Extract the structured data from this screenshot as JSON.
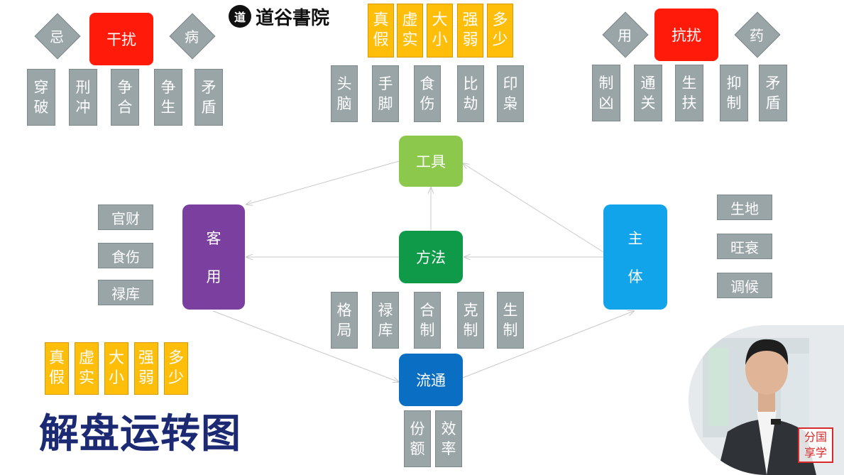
{
  "logo": {
    "icon": "道",
    "text": "道谷書院"
  },
  "top_left": {
    "red_label": "干扰",
    "left_diamond": "忌",
    "right_diamond": "病",
    "items": [
      "穿\n破",
      "刑\n冲",
      "争\n合",
      "争\n生",
      "矛\n盾"
    ]
  },
  "top_mid": {
    "yellow": [
      "真\n假",
      "虚\n实",
      "大\n小",
      "强\n弱",
      "多\n少"
    ],
    "items": [
      "头\n脑",
      "手\n脚",
      "食\n伤",
      "比\n劫",
      "印\n枭"
    ]
  },
  "top_right": {
    "red_label": "抗扰",
    "left_diamond": "用",
    "right_diamond": "药",
    "items": [
      "制\n凶",
      "通\n关",
      "生\n扶",
      "抑\n制",
      "矛\n盾"
    ]
  },
  "nodes": {
    "gongju": "工具",
    "fangfa": "方法",
    "liutong": "流通",
    "keyong": "客\n\n用",
    "zhuti": "主\n\n体"
  },
  "left_side": [
    "官财",
    "食伤",
    "禄库"
  ],
  "right_side": [
    "生地",
    "旺衰",
    "调候"
  ],
  "fangfa_items": [
    "格\n局",
    "禄\n库",
    "合\n制",
    "克\n制",
    "生\n制"
  ],
  "liutong_items": [
    "份\n额",
    "效\n率"
  ],
  "bottom_yellow": [
    "真\n假",
    "虚\n实",
    "大\n小",
    "强\n弱",
    "多\n少"
  ],
  "title": "解盘运转图",
  "stamp": "分国\n享学",
  "colors": {
    "gongju": "#8cc84b",
    "fangfa": "#0e9a48",
    "liutong": "#0a6fc2",
    "keyong": "#7b3fa0",
    "zhuti": "#12a4ea",
    "red": "#ff1a0a",
    "yellow": "#ffbe0a",
    "gray": "#9aa5a8"
  }
}
